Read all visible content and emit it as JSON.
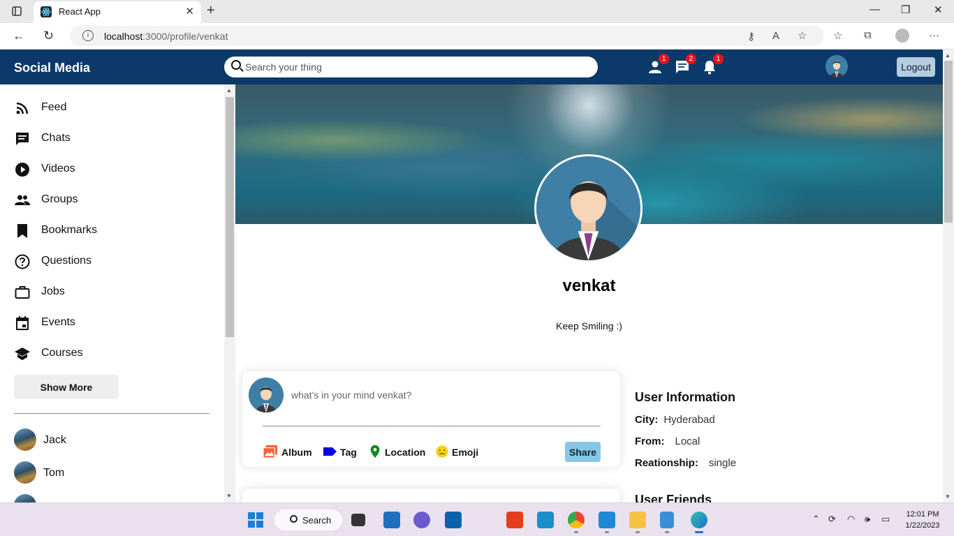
{
  "browser": {
    "tab_title": "React App",
    "url_host": "localhost",
    "url_path": ":3000/profile/venkat"
  },
  "header": {
    "logo": "Social Media",
    "search_placeholder": "Search your thing",
    "badges": {
      "friends": "1",
      "messages": "2",
      "notifications": "1"
    },
    "logout_label": "Logout"
  },
  "sidebar": {
    "items": [
      {
        "label": "Feed",
        "icon": "rss-icon"
      },
      {
        "label": "Chats",
        "icon": "chat-icon"
      },
      {
        "label": "Videos",
        "icon": "play-circle-icon"
      },
      {
        "label": "Groups",
        "icon": "group-icon"
      },
      {
        "label": "Bookmarks",
        "icon": "bookmark-icon"
      },
      {
        "label": "Questions",
        "icon": "help-circle-icon"
      },
      {
        "label": "Jobs",
        "icon": "briefcase-icon"
      },
      {
        "label": "Events",
        "icon": "calendar-icon"
      },
      {
        "label": "Courses",
        "icon": "school-icon"
      }
    ],
    "show_more_label": "Show More",
    "friends": [
      "Jack",
      "Tom"
    ]
  },
  "profile": {
    "username": "venkat",
    "bio": "Keep Smiling :)"
  },
  "share": {
    "placeholder": "what's in your mind venkat?",
    "options": [
      "Album",
      "Tag",
      "Location",
      "Emoji"
    ],
    "share_label": "Share"
  },
  "user_info": {
    "title": "User Information",
    "rows": [
      {
        "key": "City:",
        "value": "Hyderabad"
      },
      {
        "key": "From:",
        "value": "Local"
      },
      {
        "key": "Reationship:",
        "value": "single"
      }
    ],
    "friends_title": "User Friends"
  },
  "taskbar": {
    "search_label": "Search",
    "time": "12:01 PM",
    "date": "1/22/2023"
  },
  "colors": {
    "header_bg": "#0b3a6a",
    "badge": "#e8131a",
    "share_button": "#87c7e6",
    "logout_button": "#b6cde0"
  }
}
